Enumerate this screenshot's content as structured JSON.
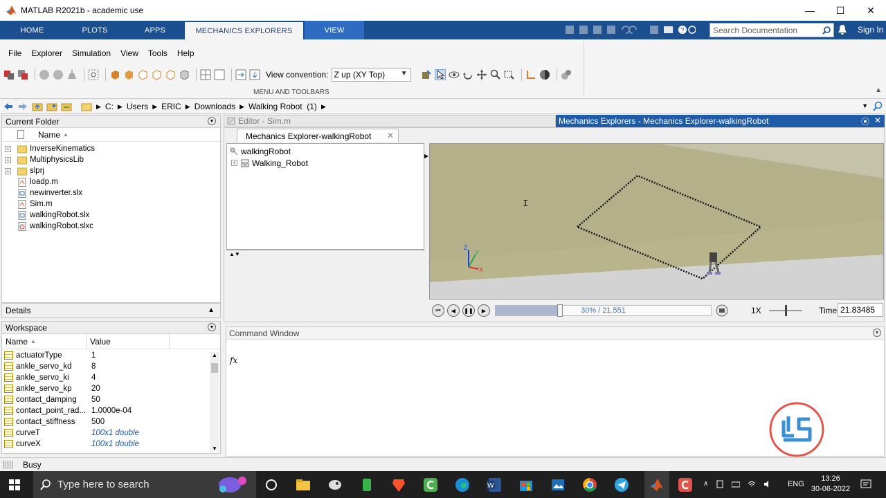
{
  "window": {
    "title": "MATLAB R2021b - academic use",
    "minimize": "—",
    "maximize": "☐",
    "close": "✕"
  },
  "tabs": [
    {
      "label": "HOME"
    },
    {
      "label": "PLOTS"
    },
    {
      "label": "APPS"
    },
    {
      "label": "MECHANICS EXPLORERS",
      "active": true
    },
    {
      "label": "VIEW"
    }
  ],
  "search": {
    "placeholder": "Search Documentation"
  },
  "signin": "Sign In",
  "ribbon": {
    "menu": [
      "File",
      "Explorer",
      "Simulation",
      "View",
      "Tools",
      "Help"
    ],
    "view_convention_label": "View convention:",
    "view_convention_value": "Z up (XY Top)",
    "group_label": "MENU AND TOOLBARS"
  },
  "address": {
    "segments": [
      "C:",
      "Users",
      "ERIC",
      "Downloads",
      "Walking Robot  (1)"
    ]
  },
  "current_folder": {
    "title": "Current Folder",
    "column": "Name",
    "items": [
      {
        "name": "InverseKinematics",
        "type": "folder",
        "expandable": true
      },
      {
        "name": "MultiphysicsLib",
        "type": "folder",
        "expandable": true
      },
      {
        "name": "slprj",
        "type": "folder",
        "expandable": true
      },
      {
        "name": "loadp.m",
        "type": "m"
      },
      {
        "name": "newinverter.slx",
        "type": "slx"
      },
      {
        "name": "Sim.m",
        "type": "m"
      },
      {
        "name": "walkingRobot.slx",
        "type": "slx"
      },
      {
        "name": "walkingRobot.slxc",
        "type": "slxc"
      }
    ]
  },
  "details": {
    "title": "Details"
  },
  "workspace": {
    "title": "Workspace",
    "columns": [
      "Name",
      "Value"
    ],
    "rows": [
      {
        "name": "actuatorType",
        "value": "1"
      },
      {
        "name": "ankle_servo_kd",
        "value": "8"
      },
      {
        "name": "ankle_servo_ki",
        "value": "4"
      },
      {
        "name": "ankle_servo_kp",
        "value": "20"
      },
      {
        "name": "contact_damping",
        "value": "50"
      },
      {
        "name": "contact_point_rad...",
        "value": "1.0000e-04"
      },
      {
        "name": "contact_stiffness",
        "value": "500"
      },
      {
        "name": "curveT",
        "value": "100x1 double",
        "italic": true
      },
      {
        "name": "curveX",
        "value": "100x1 double",
        "italic": true
      }
    ]
  },
  "editor": {
    "title": "Editor - Sim.m"
  },
  "mech_explorer": {
    "window_title": "Mechanics Explorers - Mechanics Explorer-walkingRobot",
    "doc_tab": "Mechanics Explorer-walkingRobot",
    "tree": [
      {
        "label": "walkingRobot",
        "level": 0
      },
      {
        "label": "Walking_Robot",
        "level": 1
      }
    ],
    "axis_labels": {
      "z": "Z",
      "y": "Y",
      "x": "X"
    },
    "playback": {
      "progress_text": "30% / 21.551",
      "progress": 0.3,
      "speed": "1X",
      "time_label": "Time",
      "time_value": "21.83485"
    },
    "colors": {
      "floor": "#b3b08a",
      "floor_far": "#c4c2a8",
      "background": "#d3d3d3"
    }
  },
  "command_window": {
    "title": "Command Window",
    "prompt": "fx"
  },
  "status": {
    "text": "Busy"
  },
  "taskbar": {
    "search_placeholder": "Type here to search",
    "language": "ENG",
    "time": "13:26",
    "date": "30-06-2022"
  }
}
